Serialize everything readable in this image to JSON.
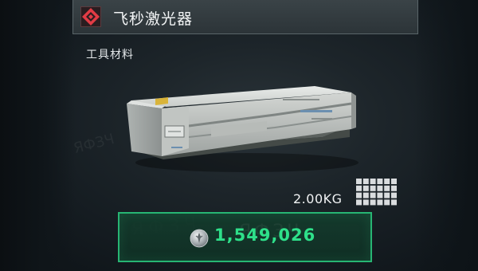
{
  "item": {
    "name": "飞秒激光器",
    "category": "工具材料",
    "weight": "2.00KG",
    "price": "1,549,026"
  },
  "icons": {
    "rarity": "red-diamond-emblem-icon",
    "size_grid": "inventory-size-grid-icon",
    "currency": "silver-coin-icon"
  },
  "size_grid": {
    "columns": 6,
    "rows": 4
  },
  "colors": {
    "rarity_accent": "#e23b45",
    "price_text": "#2ee08a",
    "price_border": "#27b573",
    "title_bar": "#323b3f"
  }
}
